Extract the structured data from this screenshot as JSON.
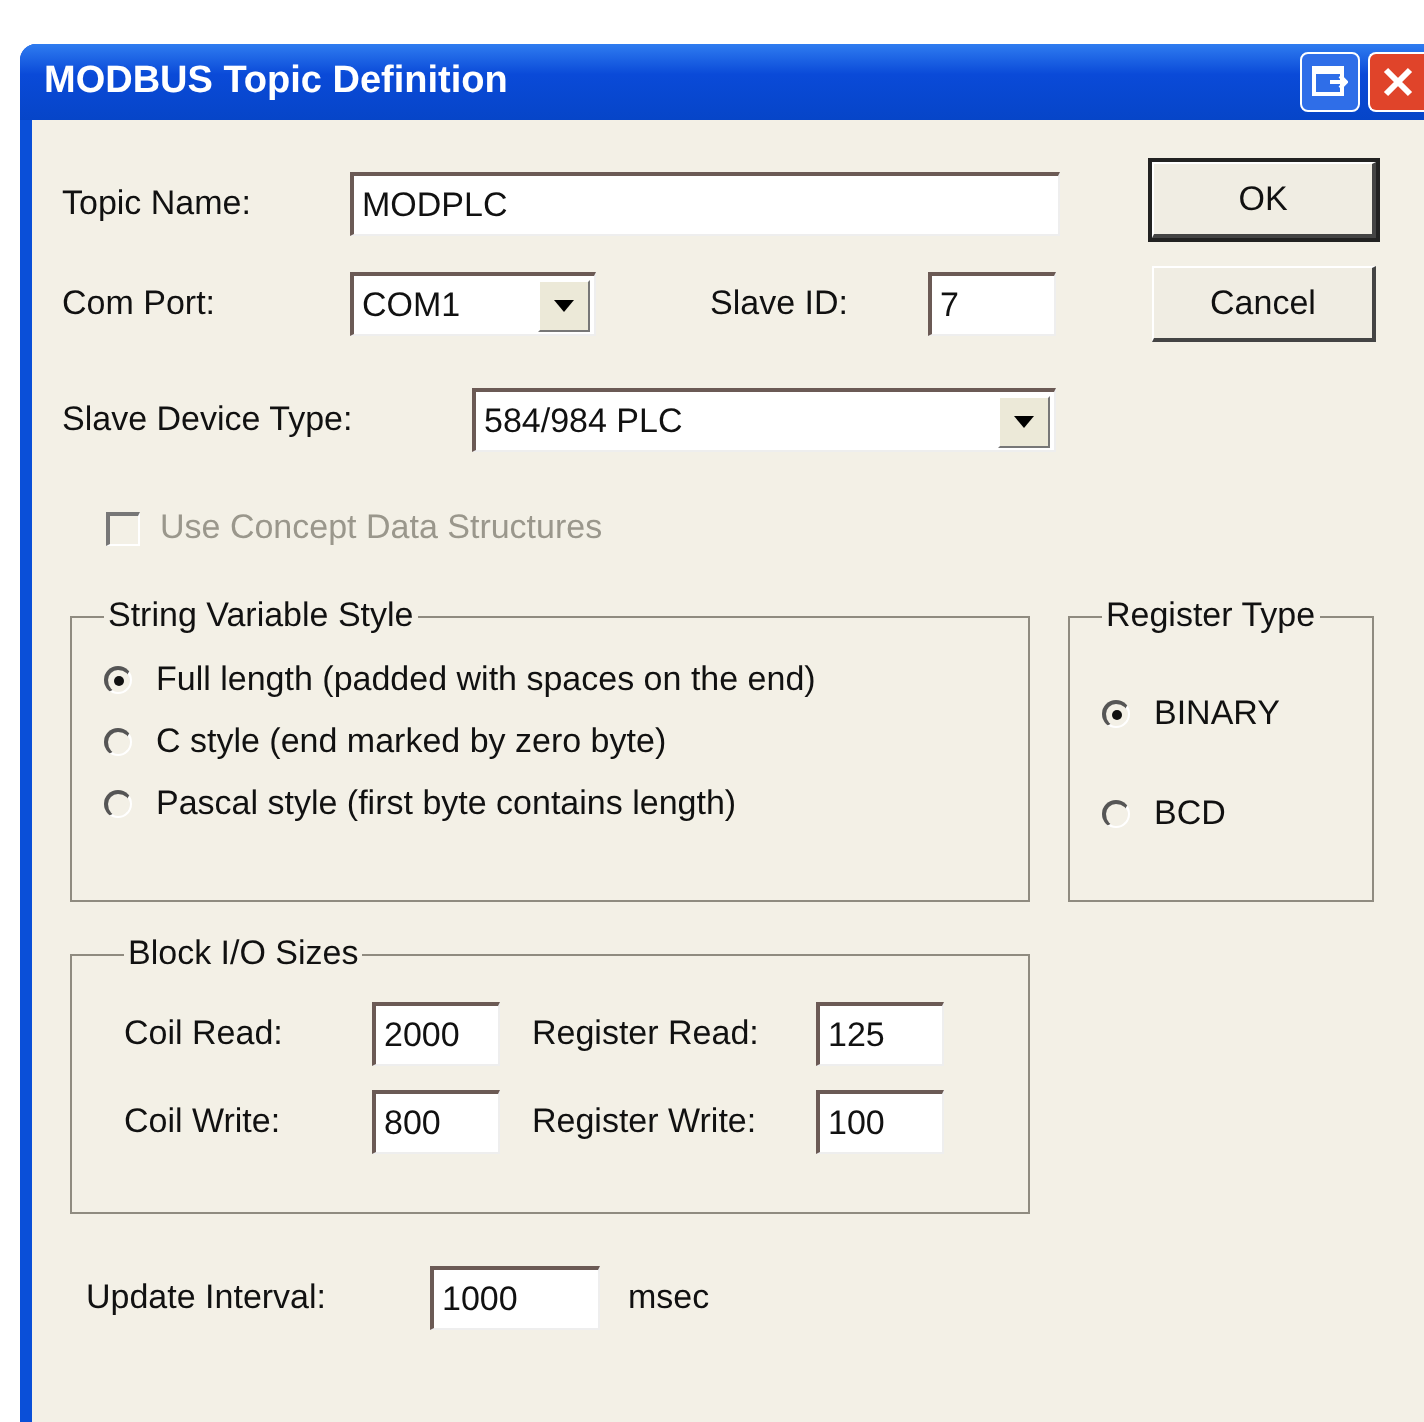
{
  "window": {
    "title": "MODBUS Topic Definition"
  },
  "topic_name": {
    "label": "Topic Name:",
    "value": "MODPLC"
  },
  "com_port": {
    "label": "Com Port:",
    "value": "COM1"
  },
  "slave_id": {
    "label": "Slave ID:",
    "value": "7"
  },
  "slave_device_type": {
    "label": "Slave Device Type:",
    "value": "584/984 PLC"
  },
  "concept_checkbox": {
    "label": "Use Concept Data Structures",
    "checked": false,
    "disabled": true
  },
  "string_variable_style": {
    "title": "String Variable Style",
    "options": [
      {
        "label": "Full length (padded with spaces on the end)",
        "selected": true
      },
      {
        "label": "C style (end marked by zero byte)",
        "selected": false
      },
      {
        "label": "Pascal style (first byte contains length)",
        "selected": false
      }
    ]
  },
  "register_type": {
    "title": "Register Type",
    "options": [
      {
        "label": "BINARY",
        "selected": true
      },
      {
        "label": "BCD",
        "selected": false
      }
    ]
  },
  "block_io_sizes": {
    "title": "Block I/O Sizes",
    "fields": [
      {
        "label": "Coil Read:",
        "value": "2000"
      },
      {
        "label": "Register Read:",
        "value": "125"
      },
      {
        "label": "Coil Write:",
        "value": "800"
      },
      {
        "label": "Register Write:",
        "value": "100"
      }
    ]
  },
  "update_interval": {
    "label": "Update Interval:",
    "value": "1000",
    "unit": "msec"
  },
  "buttons": [
    {
      "label": "OK",
      "default": true
    },
    {
      "label": "Cancel",
      "default": false
    }
  ]
}
